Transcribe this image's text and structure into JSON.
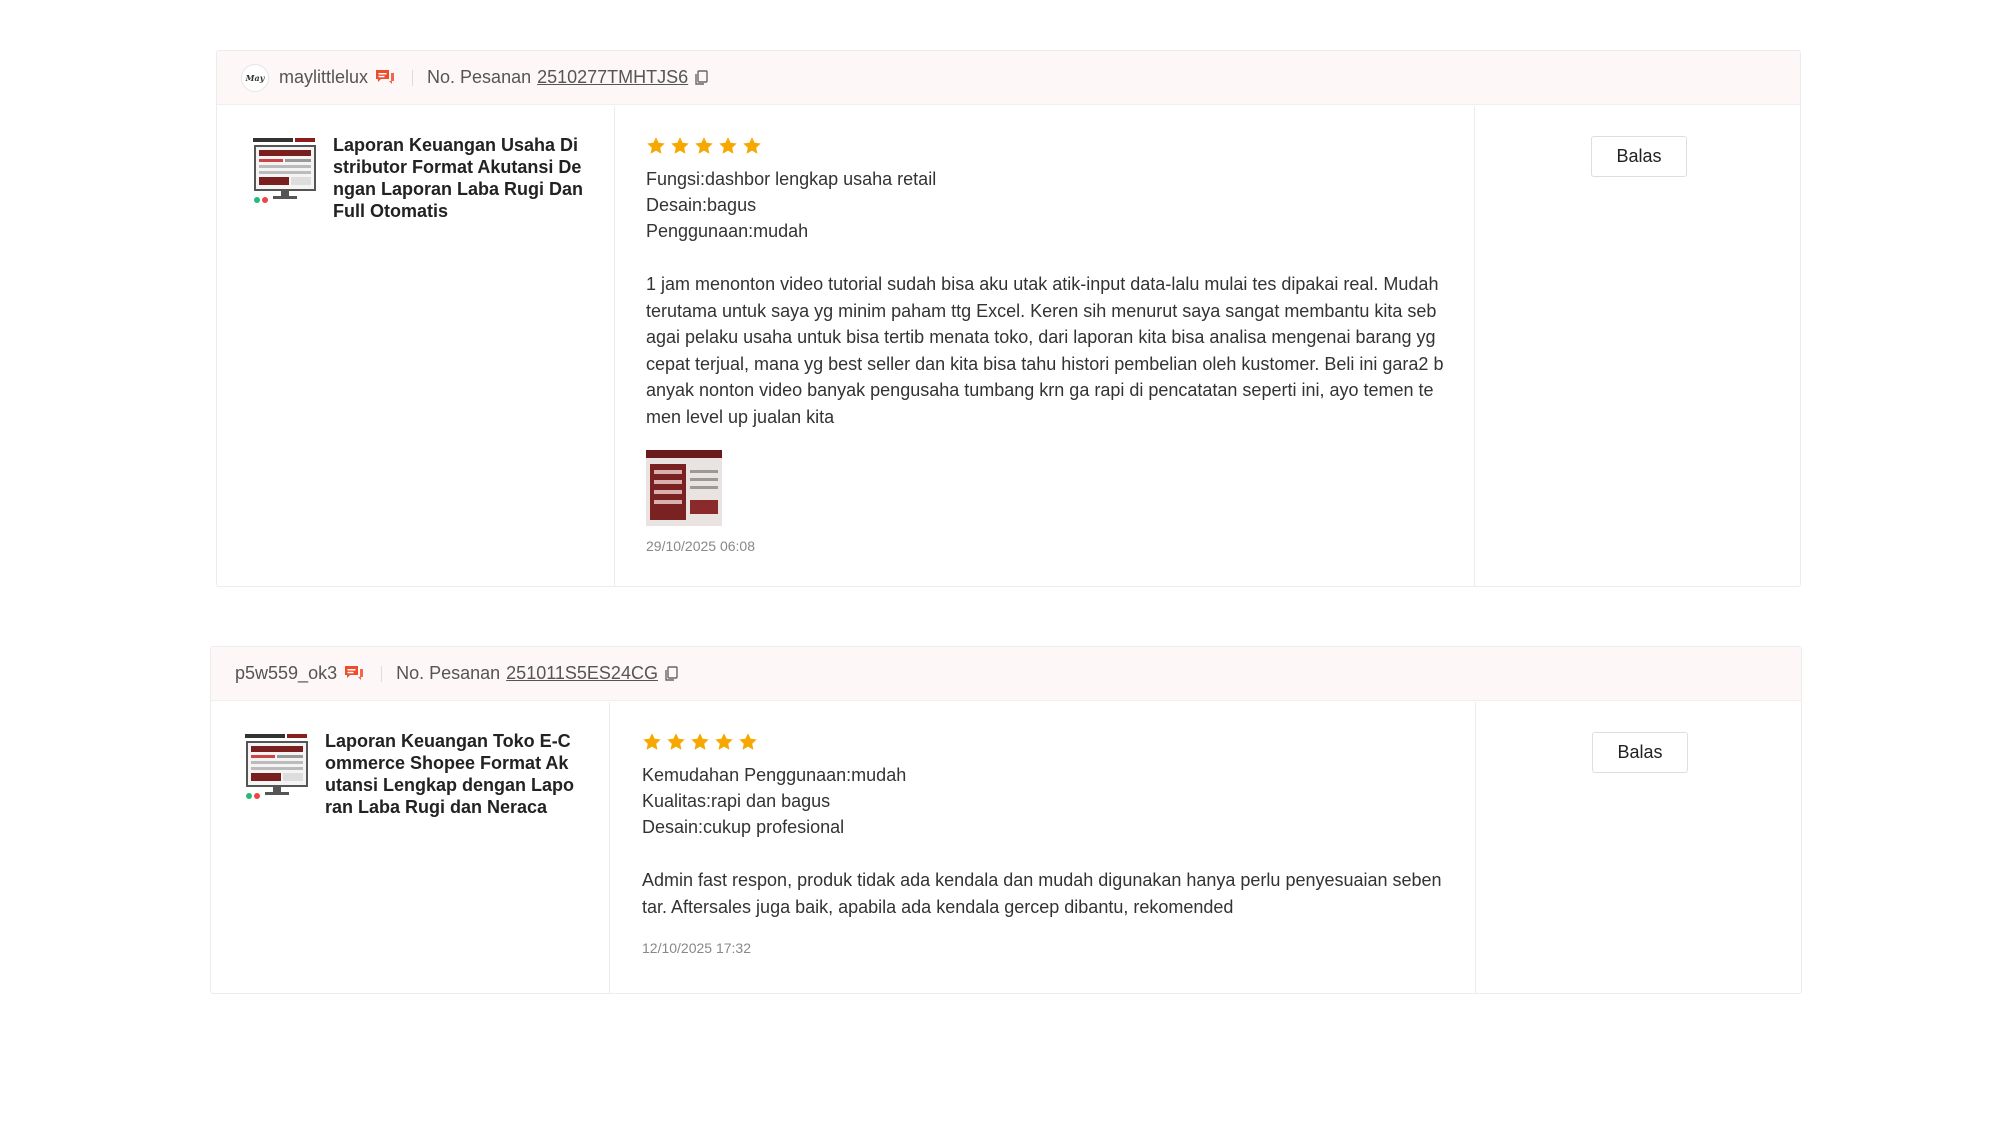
{
  "colors": {
    "star": "#f6a700",
    "chat_icon": "#ee4d2d",
    "header_bg": "#fdf7f7"
  },
  "reviews": [
    {
      "username": "maylittlelux",
      "avatar_text": "May",
      "order_label": "No. Pesanan",
      "order_no": "2510277TMHTJS6",
      "product_name": "Laporan Keuangan Usaha Distributor Format Akutansi Dengan Laporan Laba Rugi Dan Full Otomatis",
      "rating": 5,
      "attributes": [
        "Fungsi:dashbor lengkap usaha retail",
        "Desain:bagus",
        "Penggunaan:mudah"
      ],
      "text": "1 jam menonton video tutorial sudah bisa aku utak atik-input data-lalu mulai tes dipakai real. Mudah terutama untuk saya yg minim paham ttg Excel. Keren sih menurut saya sangat membantu kita sebagai pelaku usaha untuk bisa tertib menata toko, dari laporan kita bisa analisa mengenai barang yg cepat terjual, mana yg best seller dan kita bisa tahu histori pembelian oleh kustomer. Beli ini gara2 banyak nonton video banyak pengusaha tumbang krn ga rapi di pencatatan seperti ini, ayo temen temen level up jualan kita",
      "timestamp": "29/10/2025 06:08",
      "reply_label": "Balas"
    },
    {
      "username": "p5w559_ok3",
      "order_label": "No. Pesanan",
      "order_no": "251011S5ES24CG",
      "product_name": "Laporan Keuangan Toko E-Commerce Shopee Format Akutansi Lengkap dengan Laporan Laba Rugi dan Neraca",
      "rating": 5,
      "attributes": [
        "Kemudahan Penggunaan:mudah",
        "Kualitas:rapi dan bagus",
        "Desain:cukup profesional"
      ],
      "text": "Admin fast respon, produk tidak ada kendala dan mudah digunakan hanya perlu penyesuaian sebentar. Aftersales juga baik, apabila ada kendala gercep dibantu, rekomended",
      "timestamp": "12/10/2025 17:32",
      "reply_label": "Balas"
    }
  ]
}
